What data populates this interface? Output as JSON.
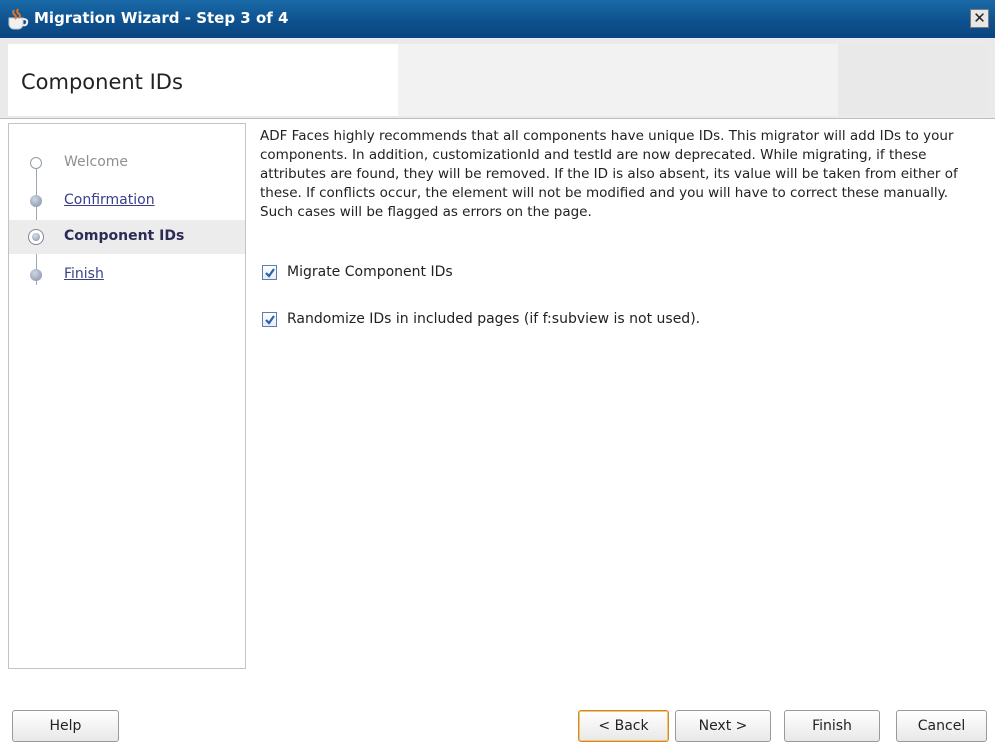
{
  "window": {
    "title": "Migration Wizard - Step 3 of 4",
    "close_glyph": "✕"
  },
  "header": {
    "title": "Component IDs"
  },
  "nav": {
    "steps": [
      {
        "label": "Welcome",
        "state": "done"
      },
      {
        "label": "Confirmation",
        "state": "link"
      },
      {
        "label": "Component IDs",
        "state": "current"
      },
      {
        "label": "Finish",
        "state": "link"
      }
    ]
  },
  "content": {
    "description": "ADF Faces highly recommends that all components have unique IDs. This migrator will add IDs to your components. In addition, customizationId and testId are now deprecated. While migrating, if these attributes are found, they will be removed. If the ID is also absent, its value will be taken from either of these. If conflicts occur, the element will not be modified and you will have to correct these manually. Such cases will be flagged as errors on the page.",
    "options": [
      {
        "label": "Migrate Component IDs",
        "checked": true
      },
      {
        "label": "Randomize IDs in included pages (if f:subview is not used).",
        "checked": true
      }
    ]
  },
  "footer": {
    "help_label": "Help",
    "back_label": "< Back",
    "next_label": "Next >",
    "finish_label": "Finish",
    "cancel_label": "Cancel"
  },
  "colors": {
    "titlebar": "#0d4f8c",
    "check": "#2f5fa8",
    "default_button_border": "#cf8a2a"
  }
}
